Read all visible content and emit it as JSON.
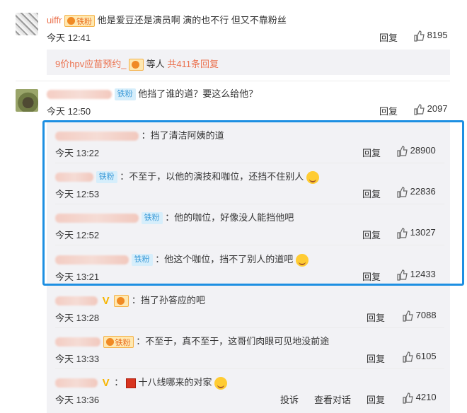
{
  "comments": [
    {
      "username": "uiffr",
      "badge": "铁粉",
      "text": "他是爱豆还是演员啊 演的也不行 但又不靠粉丝",
      "time": "今天 12:41",
      "reply_label": "回复",
      "likes": "8195"
    },
    {
      "badge": "铁粉",
      "text": "他挡了谁的道？要这么给他？",
      "time": "今天 12:50",
      "reply_label": "回复",
      "likes": "2097"
    }
  ],
  "sub_reply_summary": {
    "prefix_link": "9价hpv应苗预约_",
    "badge": "铁粉",
    "middle": "等人",
    "count_link": "共411条回复"
  },
  "replies": [
    {
      "badge": "",
      "text": "：挡了清洁阿姨的道",
      "time": "今天 13:22",
      "reply_label": "回复",
      "likes": "28900"
    },
    {
      "badge": "铁粉",
      "text": "：不至于，以他的演技和咖位，还挡不住别人",
      "time": "今天 12:53",
      "reply_label": "回复",
      "likes": "22836"
    },
    {
      "badge": "铁粉",
      "text": "：他的咖位，好像没人能挡他吧",
      "time": "今天 12:52",
      "reply_label": "回复",
      "likes": "13027"
    },
    {
      "badge": "铁粉",
      "text": "：他这个咖位，挡不了别人的道吧",
      "time": "今天 13:21",
      "reply_label": "回复",
      "likes": "12433"
    },
    {
      "badge": "铁粉",
      "text": "：挡了孙答应的吧",
      "time": "今天 13:28",
      "reply_label": "回复",
      "likes": "7088"
    },
    {
      "badge": "铁粉",
      "text": "：不至于，真不至于，这哥们肉眼可见地没前途",
      "time": "今天 13:33",
      "reply_label": "回复",
      "likes": "6105"
    },
    {
      "badge": "",
      "text": "十八线哪来的对家",
      "time": "今天 13:36",
      "report_label": "投诉",
      "dialog_label": "查看对话",
      "reply_label": "回复",
      "likes": "4210"
    }
  ],
  "colors": {
    "accent": "#eb7350",
    "highlight": "#1d8fe2",
    "panel": "#f2f2f5"
  }
}
